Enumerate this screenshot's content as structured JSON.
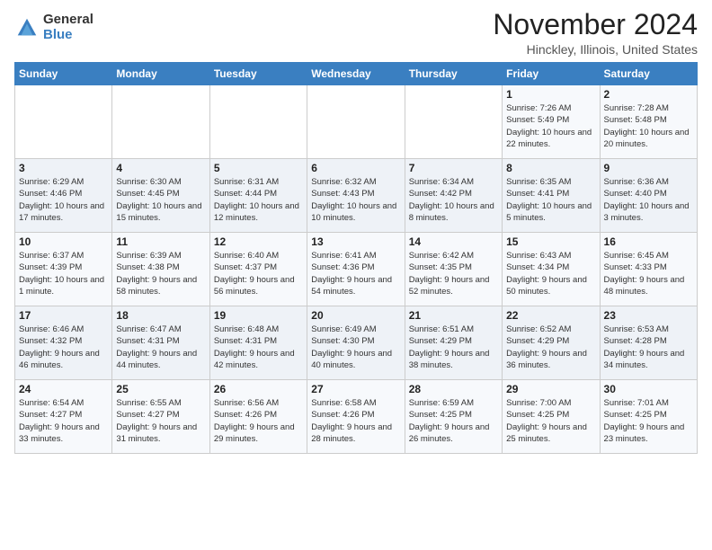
{
  "header": {
    "logo_general": "General",
    "logo_blue": "Blue",
    "main_title": "November 2024",
    "subtitle": "Hinckley, Illinois, United States"
  },
  "weekdays": [
    "Sunday",
    "Monday",
    "Tuesday",
    "Wednesday",
    "Thursday",
    "Friday",
    "Saturday"
  ],
  "weeks": [
    [
      {
        "day": "",
        "info": ""
      },
      {
        "day": "",
        "info": ""
      },
      {
        "day": "",
        "info": ""
      },
      {
        "day": "",
        "info": ""
      },
      {
        "day": "",
        "info": ""
      },
      {
        "day": "1",
        "info": "Sunrise: 7:26 AM\nSunset: 5:49 PM\nDaylight: 10 hours and 22 minutes."
      },
      {
        "day": "2",
        "info": "Sunrise: 7:28 AM\nSunset: 5:48 PM\nDaylight: 10 hours and 20 minutes."
      }
    ],
    [
      {
        "day": "3",
        "info": "Sunrise: 6:29 AM\nSunset: 4:46 PM\nDaylight: 10 hours and 17 minutes."
      },
      {
        "day": "4",
        "info": "Sunrise: 6:30 AM\nSunset: 4:45 PM\nDaylight: 10 hours and 15 minutes."
      },
      {
        "day": "5",
        "info": "Sunrise: 6:31 AM\nSunset: 4:44 PM\nDaylight: 10 hours and 12 minutes."
      },
      {
        "day": "6",
        "info": "Sunrise: 6:32 AM\nSunset: 4:43 PM\nDaylight: 10 hours and 10 minutes."
      },
      {
        "day": "7",
        "info": "Sunrise: 6:34 AM\nSunset: 4:42 PM\nDaylight: 10 hours and 8 minutes."
      },
      {
        "day": "8",
        "info": "Sunrise: 6:35 AM\nSunset: 4:41 PM\nDaylight: 10 hours and 5 minutes."
      },
      {
        "day": "9",
        "info": "Sunrise: 6:36 AM\nSunset: 4:40 PM\nDaylight: 10 hours and 3 minutes."
      }
    ],
    [
      {
        "day": "10",
        "info": "Sunrise: 6:37 AM\nSunset: 4:39 PM\nDaylight: 10 hours and 1 minute."
      },
      {
        "day": "11",
        "info": "Sunrise: 6:39 AM\nSunset: 4:38 PM\nDaylight: 9 hours and 58 minutes."
      },
      {
        "day": "12",
        "info": "Sunrise: 6:40 AM\nSunset: 4:37 PM\nDaylight: 9 hours and 56 minutes."
      },
      {
        "day": "13",
        "info": "Sunrise: 6:41 AM\nSunset: 4:36 PM\nDaylight: 9 hours and 54 minutes."
      },
      {
        "day": "14",
        "info": "Sunrise: 6:42 AM\nSunset: 4:35 PM\nDaylight: 9 hours and 52 minutes."
      },
      {
        "day": "15",
        "info": "Sunrise: 6:43 AM\nSunset: 4:34 PM\nDaylight: 9 hours and 50 minutes."
      },
      {
        "day": "16",
        "info": "Sunrise: 6:45 AM\nSunset: 4:33 PM\nDaylight: 9 hours and 48 minutes."
      }
    ],
    [
      {
        "day": "17",
        "info": "Sunrise: 6:46 AM\nSunset: 4:32 PM\nDaylight: 9 hours and 46 minutes."
      },
      {
        "day": "18",
        "info": "Sunrise: 6:47 AM\nSunset: 4:31 PM\nDaylight: 9 hours and 44 minutes."
      },
      {
        "day": "19",
        "info": "Sunrise: 6:48 AM\nSunset: 4:31 PM\nDaylight: 9 hours and 42 minutes."
      },
      {
        "day": "20",
        "info": "Sunrise: 6:49 AM\nSunset: 4:30 PM\nDaylight: 9 hours and 40 minutes."
      },
      {
        "day": "21",
        "info": "Sunrise: 6:51 AM\nSunset: 4:29 PM\nDaylight: 9 hours and 38 minutes."
      },
      {
        "day": "22",
        "info": "Sunrise: 6:52 AM\nSunset: 4:29 PM\nDaylight: 9 hours and 36 minutes."
      },
      {
        "day": "23",
        "info": "Sunrise: 6:53 AM\nSunset: 4:28 PM\nDaylight: 9 hours and 34 minutes."
      }
    ],
    [
      {
        "day": "24",
        "info": "Sunrise: 6:54 AM\nSunset: 4:27 PM\nDaylight: 9 hours and 33 minutes."
      },
      {
        "day": "25",
        "info": "Sunrise: 6:55 AM\nSunset: 4:27 PM\nDaylight: 9 hours and 31 minutes."
      },
      {
        "day": "26",
        "info": "Sunrise: 6:56 AM\nSunset: 4:26 PM\nDaylight: 9 hours and 29 minutes."
      },
      {
        "day": "27",
        "info": "Sunrise: 6:58 AM\nSunset: 4:26 PM\nDaylight: 9 hours and 28 minutes."
      },
      {
        "day": "28",
        "info": "Sunrise: 6:59 AM\nSunset: 4:25 PM\nDaylight: 9 hours and 26 minutes."
      },
      {
        "day": "29",
        "info": "Sunrise: 7:00 AM\nSunset: 4:25 PM\nDaylight: 9 hours and 25 minutes."
      },
      {
        "day": "30",
        "info": "Sunrise: 7:01 AM\nSunset: 4:25 PM\nDaylight: 9 hours and 23 minutes."
      }
    ]
  ]
}
